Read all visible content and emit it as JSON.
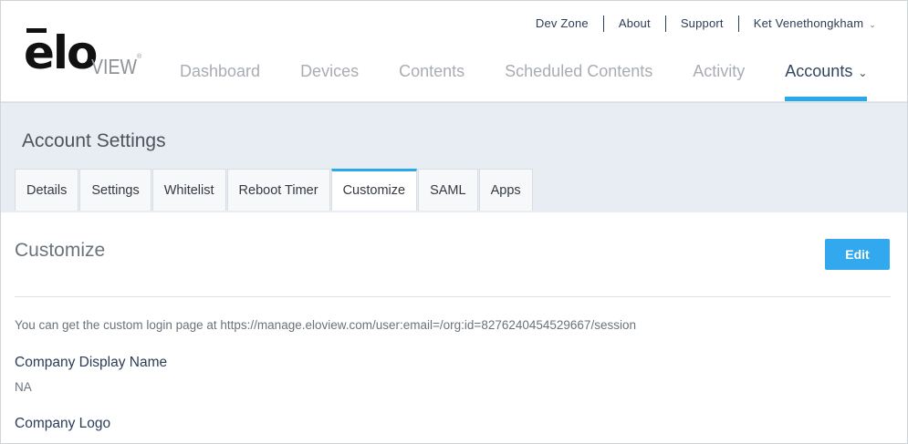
{
  "logo": {
    "brand": "elo",
    "product": "VIEW",
    "mark": "®"
  },
  "util_nav": {
    "items": [
      "Dev Zone",
      "About",
      "Support"
    ],
    "user": "Ket Venethongkham"
  },
  "main_nav": {
    "items": [
      "Dashboard",
      "Devices",
      "Contents",
      "Scheduled Contents",
      "Activity",
      "Accounts"
    ],
    "active": "Accounts"
  },
  "page": {
    "title": "Account Settings",
    "tabs": [
      "Details",
      "Settings",
      "Whitelist",
      "Reboot Timer",
      "Customize",
      "SAML",
      "Apps"
    ],
    "active_tab": "Customize"
  },
  "customize": {
    "title": "Customize",
    "edit_label": "Edit",
    "info": "You can get the custom login page at https://manage.eloview.com/user:email=/org:id=8276240454529667/session",
    "fields": [
      {
        "label": "Company Display Name",
        "value": "NA"
      },
      {
        "label": "Company Logo",
        "value": ""
      }
    ]
  },
  "colors": {
    "accent": "#29a9e8",
    "button": "#32a8ef",
    "band": "#e8edf4",
    "text_dark": "#2b3d57"
  }
}
